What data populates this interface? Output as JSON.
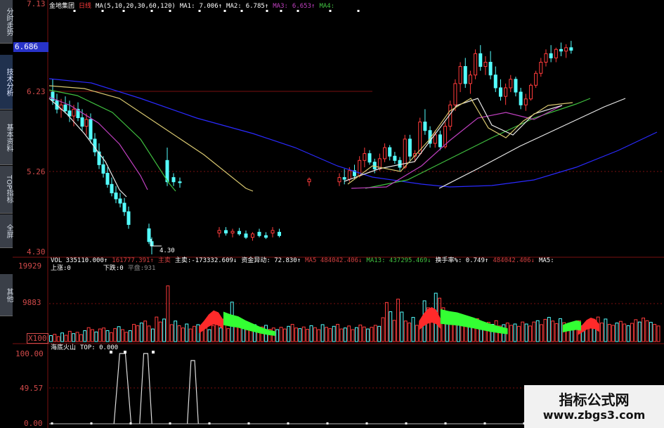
{
  "sidebar": {
    "tabs": [
      {
        "label": "分时走势",
        "active": false
      },
      {
        "label": "技术分析",
        "active": true
      },
      {
        "label": "基本资料",
        "active": false
      },
      {
        "label": "TOP指标",
        "active": false
      },
      {
        "label": "全屏",
        "active": false
      },
      {
        "label": "其他",
        "active": false
      }
    ]
  },
  "price_panel": {
    "stock_name": "金地集团",
    "period": "日线",
    "ma_params": "MA(5,10,20,30,60,120)",
    "ma_readouts": [
      {
        "label": "MA1:",
        "value": "7.006↑",
        "color": "#ffffff"
      },
      {
        "label": "MA2:",
        "value": "6.785↑",
        "color": "#ffffff"
      },
      {
        "label": "MA3:",
        "value": "6.653↑",
        "color": "#c040c0"
      },
      {
        "label": "MA4:",
        "value": "",
        "color": "#40c040"
      }
    ],
    "y_labels": [
      "7.13",
      "6.23",
      "5.26",
      "4.30"
    ],
    "current_price_box": "6.686",
    "low_marker": "4.30"
  },
  "volume_panel": {
    "header": [
      {
        "text": "VOL 335110.000↑",
        "color": "#ffffff"
      },
      {
        "text": "161777.391↑",
        "color": "#d04040"
      },
      {
        "text": "主卖",
        "color": "#d04040"
      },
      {
        "text": "主卖:-173332.609↓",
        "color": "#ffffff"
      },
      {
        "text": "资金异动: 72.830↑",
        "color": "#ffffff"
      },
      {
        "text": "MA5  484042.406↓",
        "color": "#d04040"
      },
      {
        "text": "MA13: 437295.469↓",
        "color": "#40c040"
      },
      {
        "text": "换手率%: 0.749↑",
        "color": "#ffffff"
      },
      {
        "text": "484042.406↓",
        "color": "#d04040"
      },
      {
        "text": "MA5:",
        "color": "#ffffff"
      }
    ],
    "sub_labels": {
      "up": "上涨:0",
      "down": "下跌:0",
      "flat": "平盘:931"
    },
    "y_labels": [
      "19929",
      "9883",
      "X100"
    ]
  },
  "indicator_panel": {
    "name": "海底火山",
    "top_label": "TOP: 0.000",
    "y_labels": [
      "100.00",
      "49.57",
      "0.00"
    ]
  },
  "watermark": {
    "line1": "指标公式网",
    "line2": "www.zbgs3.com"
  },
  "colors": {
    "up": "#ff3b3b",
    "down": "#54ffff",
    "ma_white": "#e8e8e8",
    "ma_yellow": "#d9c870",
    "ma_magenta": "#c040c0",
    "ma_green": "#3fbf3f",
    "ma_blue": "#2a2aff",
    "grid": "#7a1010"
  },
  "chart_data": [
    {
      "type": "candlestick",
      "title": "金地集团 日线",
      "ylim": [
        4.3,
        7.13
      ],
      "y_ticks": [
        4.3,
        5.26,
        6.23,
        7.13
      ],
      "candles": [
        [
          6.2,
          6.35,
          6.05,
          6.1
        ],
        [
          6.1,
          6.18,
          5.95,
          6.0
        ],
        [
          6.0,
          6.12,
          5.9,
          6.05
        ],
        [
          6.05,
          6.15,
          5.95,
          5.98
        ],
        [
          5.98,
          6.1,
          5.85,
          5.92
        ],
        [
          5.92,
          6.05,
          5.8,
          6.0
        ],
        [
          6.0,
          6.08,
          5.86,
          5.9
        ],
        [
          5.9,
          6.0,
          5.75,
          5.8
        ],
        [
          5.8,
          5.95,
          5.7,
          5.88
        ],
        [
          5.88,
          5.95,
          5.6,
          5.65
        ],
        [
          5.65,
          5.72,
          5.45,
          5.5
        ],
        [
          5.5,
          5.6,
          5.3,
          5.35
        ],
        [
          5.35,
          5.45,
          5.2,
          5.25
        ],
        [
          5.25,
          5.32,
          5.08,
          5.12
        ],
        [
          5.12,
          5.2,
          4.98,
          5.02
        ],
        [
          5.02,
          5.1,
          4.9,
          4.95
        ],
        [
          4.95,
          5.02,
          4.85,
          4.9
        ],
        [
          4.9,
          4.96,
          4.75,
          4.8
        ],
        [
          4.8,
          4.86,
          4.6,
          4.65
        ],
        [
          5.4,
          5.55,
          5.1,
          5.15
        ],
        [
          5.2,
          5.25,
          5.1,
          5.15
        ],
        [
          5.15,
          5.2,
          5.08,
          5.14
        ],
        [
          4.6,
          4.66,
          4.42,
          4.45
        ],
        [
          4.45,
          4.5,
          4.3,
          4.4
        ],
        [
          4.55,
          4.62,
          4.5,
          4.58
        ],
        [
          4.58,
          4.62,
          4.52,
          4.55
        ],
        [
          4.55,
          4.6,
          4.5,
          4.57
        ],
        [
          4.57,
          4.61,
          4.52,
          4.54
        ],
        [
          4.54,
          4.58,
          4.48,
          4.5
        ],
        [
          4.5,
          4.56,
          4.46,
          4.54
        ],
        [
          4.56,
          4.6,
          4.5,
          4.52
        ],
        [
          4.52,
          4.56,
          4.48,
          4.5
        ],
        [
          4.55,
          4.62,
          4.5,
          4.58
        ],
        [
          4.56,
          4.6,
          4.5,
          4.52
        ],
        [
          5.15,
          5.2,
          5.1,
          5.18
        ],
        [
          5.15,
          5.25,
          5.1,
          5.2
        ],
        [
          5.2,
          5.3,
          5.12,
          5.18
        ],
        [
          5.18,
          5.32,
          5.15,
          5.28
        ],
        [
          5.28,
          5.35,
          5.18,
          5.22
        ],
        [
          5.22,
          5.45,
          5.2,
          5.4
        ],
        [
          5.4,
          5.55,
          5.32,
          5.48
        ],
        [
          5.48,
          5.52,
          5.35,
          5.38
        ],
        [
          5.38,
          5.42,
          5.25,
          5.3
        ],
        [
          5.3,
          5.48,
          5.28,
          5.42
        ],
        [
          5.42,
          5.6,
          5.38,
          5.55
        ],
        [
          5.55,
          5.58,
          5.4,
          5.45
        ],
        [
          5.45,
          5.5,
          5.36,
          5.4
        ],
        [
          5.4,
          5.44,
          5.28,
          5.32
        ],
        [
          5.32,
          5.7,
          5.3,
          5.65
        ],
        [
          5.65,
          5.7,
          5.4,
          5.45
        ],
        [
          5.45,
          5.52,
          5.38,
          5.48
        ],
        [
          5.48,
          5.9,
          5.46,
          5.85
        ],
        [
          5.85,
          6.0,
          5.7,
          5.75
        ],
        [
          5.75,
          5.8,
          5.55,
          5.6
        ],
        [
          5.6,
          5.75,
          5.55,
          5.7
        ],
        [
          5.7,
          5.75,
          5.52,
          5.56
        ],
        [
          5.56,
          5.85,
          5.54,
          5.8
        ],
        [
          5.8,
          6.1,
          5.75,
          6.05
        ],
        [
          6.05,
          6.35,
          5.98,
          6.3
        ],
        [
          6.3,
          6.55,
          6.2,
          6.5
        ],
        [
          6.5,
          6.6,
          6.25,
          6.3
        ],
        [
          6.3,
          6.45,
          6.18,
          6.4
        ],
        [
          6.4,
          6.7,
          6.35,
          6.65
        ],
        [
          6.65,
          6.75,
          6.45,
          6.5
        ],
        [
          6.5,
          6.62,
          6.4,
          6.55
        ],
        [
          6.55,
          6.68,
          6.35,
          6.4
        ],
        [
          6.4,
          6.5,
          6.2,
          6.25
        ],
        [
          6.25,
          6.35,
          6.1,
          6.15
        ],
        [
          6.15,
          6.3,
          6.05,
          6.25
        ],
        [
          6.25,
          6.4,
          6.2,
          6.35
        ],
        [
          6.35,
          6.38,
          6.15,
          6.2
        ],
        [
          6.2,
          6.25,
          6.0,
          6.05
        ],
        [
          6.05,
          6.18,
          5.98,
          6.12
        ],
        [
          6.12,
          6.3,
          6.1,
          6.28
        ],
        [
          6.28,
          6.45,
          6.25,
          6.42
        ],
        [
          6.42,
          6.6,
          6.38,
          6.55
        ],
        [
          6.55,
          6.7,
          6.5,
          6.65
        ],
        [
          6.65,
          6.75,
          6.55,
          6.6
        ],
        [
          6.6,
          6.72,
          6.55,
          6.7
        ],
        [
          6.7,
          6.78,
          6.62,
          6.68
        ],
        [
          6.68,
          6.76,
          6.6,
          6.72
        ],
        [
          6.72,
          6.8,
          6.65,
          6.69
        ]
      ]
    },
    {
      "type": "bar",
      "title": "VOL",
      "ylim": [
        0,
        19929
      ],
      "y_ticks": [
        9883,
        19929
      ],
      "values": [
        1800,
        2200,
        1500,
        2600,
        1900,
        3100,
        2400,
        2800,
        2100,
        3300,
        4200,
        3600,
        2900,
        3800,
        4100,
        3300,
        2700,
        3900,
        4500,
        3600,
        2800,
        3300,
        5200,
        4800,
        5600,
        6200,
        4700,
        3800,
        7400,
        5900,
        6800,
        16800,
        5100,
        6200,
        4800,
        4100,
        5300,
        3800,
        4600,
        5100,
        3900,
        4300,
        3600,
        4800,
        5200,
        4100,
        6800,
        3900,
        11900,
        5600,
        4300,
        4700,
        3800,
        4200,
        5100,
        3600,
        4400,
        4900,
        3700,
        4100,
        3600,
        4300,
        3800,
        4600,
        5200,
        4100,
        3900,
        4400,
        3700,
        4800,
        4200,
        3600,
        5100,
        4300,
        3900,
        4600,
        5200,
        3800,
        4100,
        4700,
        3600,
        4200,
        5000,
        4400,
        3800,
        4300,
        4900,
        4600,
        7200,
        11800,
        9000,
        6400,
        12800,
        8900,
        6200,
        5600,
        7300,
        4900,
        5600,
        12300,
        10200,
        8400,
        14600,
        13100,
        10200,
        8800,
        7200,
        6400,
        5800,
        7000,
        5600,
        6300,
        5100,
        6900,
        5400,
        4900,
        5800,
        5200,
        6300,
        4700,
        5100,
        5600,
        4900,
        5300,
        4600,
        5900,
        5300,
        4700,
        5900,
        6300,
        5100,
        6700,
        7300,
        6200,
        5400,
        6900,
        5700,
        5100,
        4600,
        5600,
        6300,
        4800,
        5200,
        5900,
        6400,
        7400,
        5600,
        6800,
        5200,
        4900,
        5600,
        6100,
        5300,
        4800,
        5500,
        6600,
        5900,
        7100,
        6300,
        5800,
        5200,
        4700
      ],
      "red_flags": [
        {
          "from": 0.245,
          "to": 0.285,
          "values": [
            4500,
            6200,
            8200,
            9400,
            8800,
            6500
          ]
        },
        {
          "from": 0.605,
          "to": 0.64,
          "values": [
            6200,
            8300,
            9800,
            10400,
            9600,
            7000
          ]
        },
        {
          "from": 0.865,
          "to": 0.9,
          "values": [
            3600,
            5000,
            6500,
            7200,
            6800,
            5200
          ]
        }
      ],
      "green_flags": [
        {
          "from": 0.285,
          "to": 0.37,
          "values": [
            9000,
            8200,
            7600,
            6400,
            5400,
            4400,
            3600,
            3100
          ]
        },
        {
          "from": 0.64,
          "to": 0.75,
          "values": [
            9800,
            9200,
            8800,
            8000,
            7200,
            6200,
            5300,
            4600,
            4000
          ]
        },
        {
          "from": 0.84,
          "to": 0.87,
          "values": [
            5000,
            5600,
            6000,
            6400,
            6000
          ]
        }
      ]
    },
    {
      "type": "line",
      "title": "海底火山",
      "ylim": [
        0,
        100
      ],
      "y_ticks": [
        0,
        49.57,
        100
      ],
      "values": [
        0,
        0,
        0,
        0,
        0,
        0,
        0,
        0,
        0,
        0,
        0,
        0,
        0,
        0,
        0,
        0,
        0,
        0,
        0,
        0,
        0,
        0,
        0,
        0,
        0,
        0,
        0,
        0,
        0,
        0,
        0,
        0,
        0,
        0,
        0,
        0,
        0,
        0,
        0,
        0,
        0,
        0,
        0,
        0,
        0,
        0,
        0,
        0,
        0,
        0,
        0,
        0,
        0,
        0,
        0,
        0,
        0,
        0,
        0,
        0,
        0,
        0,
        0,
        0,
        0,
        0,
        0,
        0,
        0,
        0,
        0,
        0,
        0,
        0,
        0,
        0,
        0,
        0,
        0,
        0,
        0,
        0,
        0,
        0,
        0,
        0,
        0,
        0,
        0,
        0,
        0,
        0,
        0,
        0,
        0,
        0,
        0,
        0,
        0,
        0,
        0,
        0,
        0,
        0,
        0,
        0,
        0,
        0,
        0,
        0,
        0,
        0,
        0,
        0,
        0,
        0,
        0,
        0,
        0,
        0,
        0,
        0,
        0,
        0,
        0,
        0,
        0,
        0,
        0,
        0,
        0,
        0,
        0,
        0,
        0,
        0,
        0,
        0,
        0,
        0,
        0,
        0,
        0,
        0,
        0,
        0,
        0,
        0,
        0,
        0,
        0,
        0,
        0,
        0,
        0,
        0,
        0,
        0,
        0,
        0,
        0,
        0,
        0,
        0,
        0,
        0,
        0,
        0,
        0,
        0,
        0,
        0,
        0,
        0,
        0,
        0,
        0,
        0,
        0,
        0
      ],
      "spikes": [
        {
          "at": 0.12,
          "width": 0.028,
          "value": 100
        },
        {
          "at": 0.158,
          "width": 0.02,
          "value": 100
        },
        {
          "at": 0.235,
          "width": 0.018,
          "value": 90
        }
      ]
    }
  ]
}
